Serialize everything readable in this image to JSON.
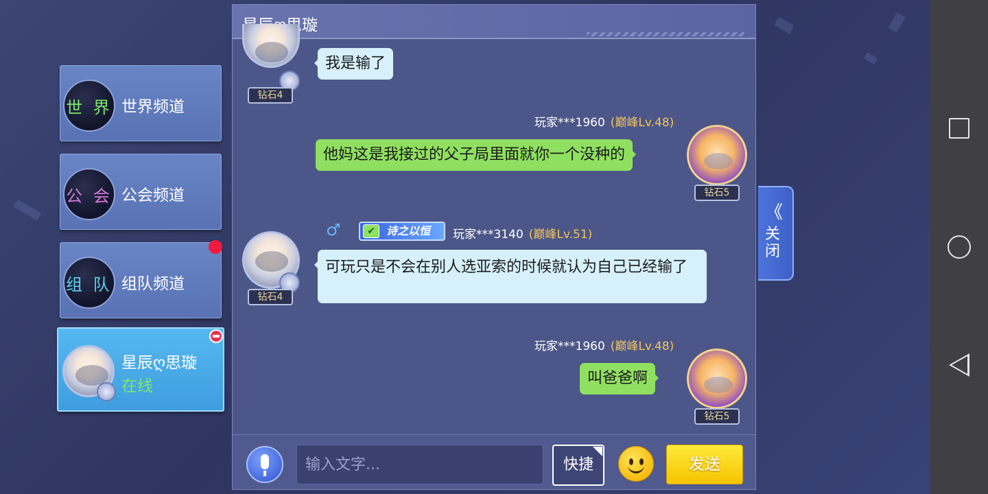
{
  "channels": [
    {
      "icon_text": "世 界",
      "icon_color": "#7de86a",
      "label": "世界频道",
      "has_notification": false
    },
    {
      "icon_text": "公 会",
      "icon_color": "#d77ad9",
      "label": "公会频道",
      "has_notification": false
    },
    {
      "icon_text": "组 队",
      "icon_color": "#5fd1f0",
      "label": "组队频道",
      "has_notification": true
    }
  ],
  "private_chat": {
    "name": "星辰ღ思璇",
    "status": "在线",
    "status_color": "#7de86a"
  },
  "chat": {
    "title": "星辰ღ思璇",
    "messages": [
      {
        "side": "left",
        "text": "我是输了",
        "rank": "钻石4"
      },
      {
        "side": "right",
        "player": "玩家***1960",
        "level": "(巅峰Lv.48)",
        "text": "他妈这是我接过的父子局里面就你一个没种的",
        "rank": "钻石5"
      },
      {
        "side": "left",
        "gender_icon": "♂",
        "honor_badge": "诗之以恒",
        "player": "玩家***3140",
        "level": "(巅峰Lv.51)",
        "text": "可玩只是不会在别人选亚索的时候就认为自己已经输了",
        "rank": "钻石4"
      },
      {
        "side": "right",
        "player": "玩家***1960",
        "level": "(巅峰Lv.48)",
        "text": "叫爸爸啊",
        "rank": "钻石5"
      }
    ]
  },
  "input": {
    "placeholder": "输入文字...",
    "quick_label": "快捷",
    "send_label": "发送"
  },
  "close_tab": {
    "chevron": "《",
    "label": "关闭"
  },
  "icons": {
    "mic": "microphone-icon",
    "emoji": "smiley-icon",
    "remove": "minus-circle-icon",
    "check": "checkmark-icon",
    "nav_recent": "square-icon",
    "nav_home": "circle-icon",
    "nav_back": "triangle-back-icon"
  },
  "colors": {
    "panel_bg": "#4d5688",
    "left_bubble": "#d6f1fb",
    "right_bubble": "#8fe060",
    "level_text": "#f0c45b",
    "send_button": "#f5c400",
    "notification_dot": "#f21b3f"
  }
}
